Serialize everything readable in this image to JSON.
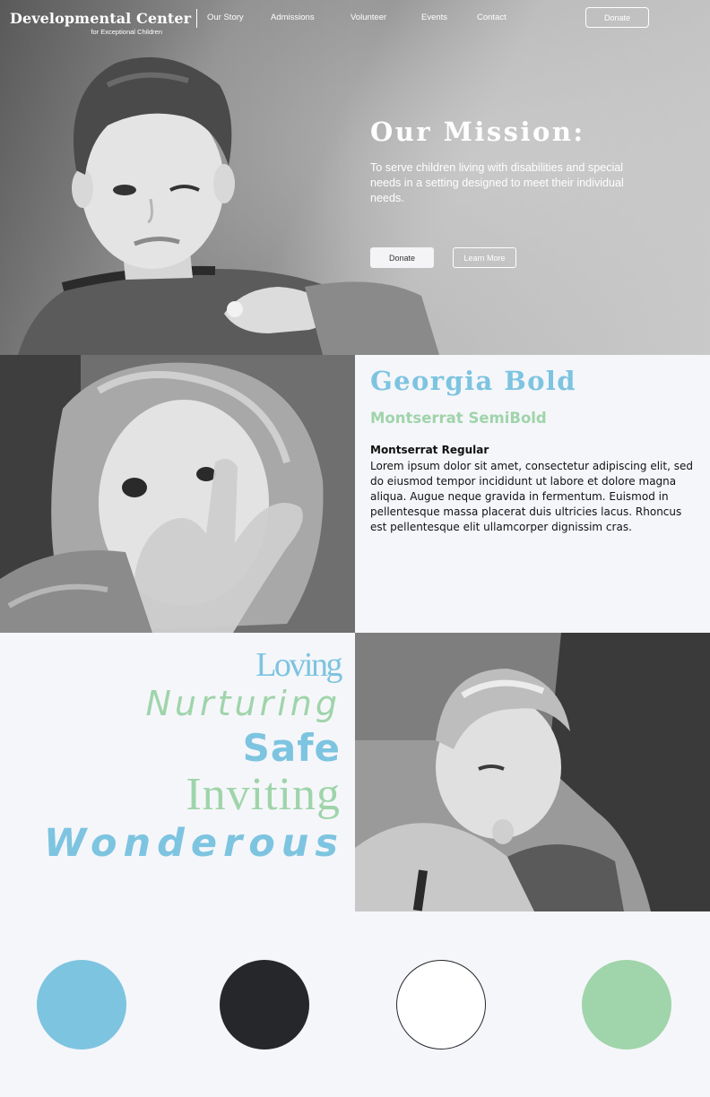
{
  "header": {
    "brand_title": "Developmental Center",
    "brand_subtitle": "for Exceptional Children",
    "nav": [
      {
        "label": "Our Story"
      },
      {
        "label": "Admissions"
      },
      {
        "label": "Volunteer"
      },
      {
        "label": "Events"
      },
      {
        "label": "Contact"
      }
    ],
    "donate_label": "Donate"
  },
  "hero": {
    "title": "Our Mission:",
    "text": "To serve children living with disabilities and special needs in a setting designed to meet their individual needs.",
    "donate_label": "Donate",
    "learn_more_label": "Learn More"
  },
  "typography": {
    "heading": "Georgia Bold",
    "subheading": "Montserrat SemiBold",
    "body_label": "Montserrat Regular",
    "body_text": "Lorem ipsum dolor sit amet, consectetur adipiscing elit, sed do eiusmod tempor incididunt ut labore et dolore magna aliqua. Augue neque gravida in fermentum. Euismod in pellentesque massa placerat duis ultricies lacus. Rhoncus est pellentesque elit ullamcorper dignissim cras."
  },
  "words": [
    "Loving",
    "Nurturing",
    "Safe",
    "Inviting",
    "Wonderous"
  ],
  "palette": {
    "blue": "#7DC4E0",
    "dark": "#25272B",
    "white": "#FFFFFF",
    "green": "#A0D4AA"
  }
}
